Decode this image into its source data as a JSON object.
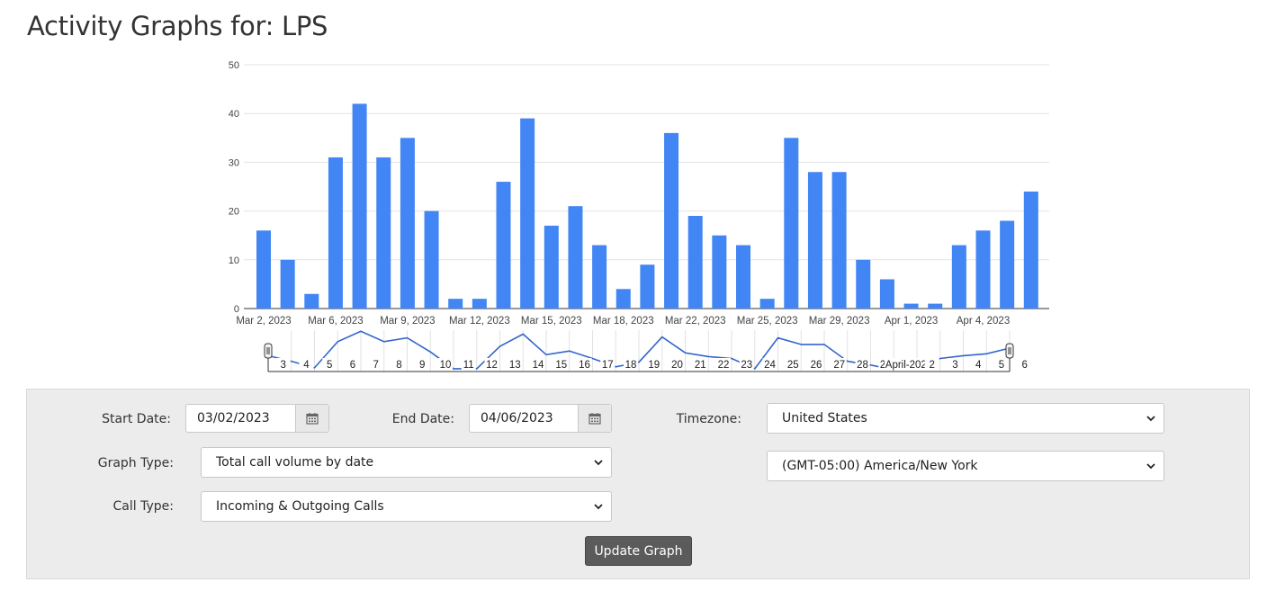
{
  "page": {
    "title": "Activity Graphs for: LPS"
  },
  "chart_data": {
    "type": "bar",
    "title": "",
    "xlabel": "",
    "ylabel": "",
    "ylim": [
      0,
      50
    ],
    "yticks": [
      0,
      10,
      20,
      30,
      40,
      50
    ],
    "grid": true,
    "bar_color": "#4285f4",
    "categories": [
      "2023-03-02",
      "2023-03-03",
      "2023-03-04",
      "2023-03-05",
      "2023-03-06",
      "2023-03-07",
      "2023-03-08",
      "2023-03-09",
      "2023-03-10",
      "2023-03-11",
      "2023-03-12",
      "2023-03-13",
      "2023-03-14",
      "2023-03-15",
      "2023-03-16",
      "2023-03-17",
      "2023-03-18",
      "2023-03-19",
      "2023-03-20",
      "2023-03-21",
      "2023-03-22",
      "2023-03-23",
      "2023-03-24",
      "2023-03-25",
      "2023-03-26",
      "2023-03-27",
      "2023-03-28",
      "2023-03-29",
      "2023-03-30",
      "2023-03-31",
      "2023-04-01",
      "2023-04-02",
      "2023-04-03",
      "2023-04-04",
      "2023-04-05",
      "2023-04-06"
    ],
    "values": [
      16,
      10,
      3,
      31,
      42,
      31,
      35,
      20,
      2,
      2,
      26,
      39,
      17,
      21,
      13,
      4,
      9,
      36,
      19,
      15,
      13,
      2,
      35,
      28,
      28,
      10,
      6,
      1,
      1,
      13,
      16,
      18,
      24
    ],
    "x_tick_labels": [
      {
        "label": "Mar 2, 2023",
        "index": 0
      },
      {
        "label": "Mar 6, 2023",
        "index": 3
      },
      {
        "label": "Mar 9, 2023",
        "index": 6
      },
      {
        "label": "Mar 12, 2023",
        "index": 9
      },
      {
        "label": "Mar 15, 2023",
        "index": 12
      },
      {
        "label": "Mar 18, 2023",
        "index": 15
      },
      {
        "label": "Mar 22, 2023",
        "index": 18
      },
      {
        "label": "Mar 25, 2023",
        "index": 21
      },
      {
        "label": "Mar 29, 2023",
        "index": 24
      },
      {
        "label": "Apr 1, 2023",
        "index": 27
      },
      {
        "label": "Apr 4, 2023",
        "index": 30
      }
    ],
    "range_selector": {
      "labels": [
        "3",
        "4",
        "5",
        "6",
        "7",
        "8",
        "9",
        "10",
        "11",
        "12",
        "13",
        "14",
        "15",
        "16",
        "17",
        "18",
        "19",
        "20",
        "21",
        "22",
        "23",
        "24",
        "25",
        "26",
        "27",
        "28",
        "29",
        "April-2023",
        "2",
        "3",
        "4",
        "5",
        "6"
      ],
      "line_color": "#3366cc"
    }
  },
  "controls": {
    "start_date": {
      "label": "Start Date:",
      "value": "03/02/2023"
    },
    "end_date": {
      "label": "End Date:",
      "value": "04/06/2023"
    },
    "timezone": {
      "label": "Timezone:",
      "country": "United States",
      "zone": "(GMT-05:00) America/New York"
    },
    "graph_type": {
      "label": "Graph Type:",
      "value": "Total call volume by date"
    },
    "call_type": {
      "label": "Call Type:",
      "value": "Incoming & Outgoing Calls"
    },
    "update_button": "Update Graph"
  },
  "icons": {
    "calendar": "calendar-icon",
    "chevron": "chevron-down-icon"
  }
}
